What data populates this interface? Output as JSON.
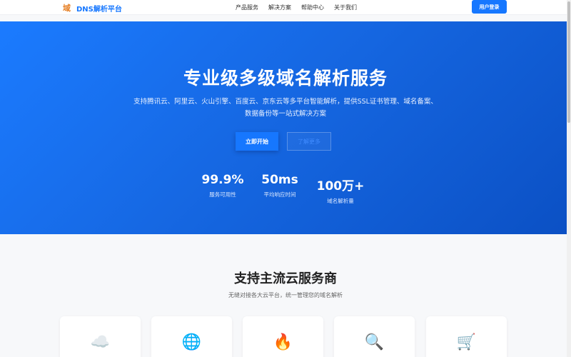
{
  "header": {
    "logo_icon": "域",
    "logo_text": "DNS解析平台",
    "nav": [
      "产品服务",
      "解决方案",
      "帮助中心",
      "关于我们"
    ],
    "login_label": "用户登录"
  },
  "hero": {
    "title": "专业级多级域名解析服务",
    "subtitle_line1": "支持腾讯云、阿里云、火山引擎、百度云、京东云等多平台智能解析，提供SSL证书管理、域名备案、",
    "subtitle_line2": "数据备份等一站式解决方案",
    "primary_button": "立即开始",
    "secondary_button": "了解更多",
    "stats": [
      {
        "value": "99.9%",
        "label": "服务可用性"
      },
      {
        "value": "50ms",
        "label": "平均响应时间"
      },
      {
        "value": "100万+",
        "label": "域名解析量"
      }
    ]
  },
  "providers": {
    "title": "支持主流云服务商",
    "subtitle": "无缝对接各大云平台，统一管理您的域名解析",
    "cards": [
      {
        "icon": "☁️",
        "icon_name": "cloud-icon"
      },
      {
        "icon": "🌐",
        "icon_name": "globe-icon"
      },
      {
        "icon": "🔥",
        "icon_name": "fire-icon"
      },
      {
        "icon": "🔍",
        "icon_name": "magnifier-icon"
      },
      {
        "icon": "🛒",
        "icon_name": "cart-icon"
      }
    ]
  },
  "colors": {
    "brand": "#1677ff",
    "logo_icon": "#e67e22"
  }
}
